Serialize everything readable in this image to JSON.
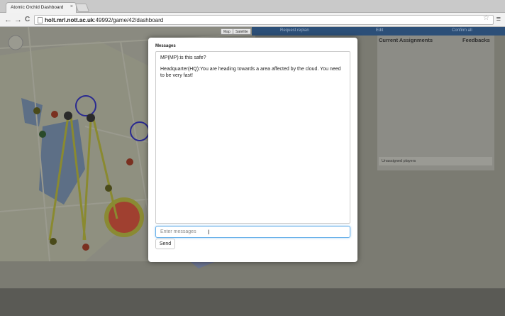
{
  "browser": {
    "tab_title": "Atomic Orchid Dashboard",
    "tab_close": "×",
    "back": "←",
    "forward": "→",
    "reload": "C",
    "url_host": "holt.mrl.nott.ac.uk",
    "url_path": ":49992/game/42/dashboard",
    "star": "☆",
    "menu": "≡"
  },
  "map": {
    "map_btn": "Map",
    "satellite_btn": "Satellite"
  },
  "top_tabs": [
    "Request replan",
    "Edit",
    "Confirm all"
  ],
  "assignments": {
    "current_label": "Current Assignments",
    "feedbacks_label": "Feedbacks",
    "unassigned_label": "Unassigned players"
  },
  "modal": {
    "title": "Messages",
    "messages": [
      "MP(MP):is this safe?",
      "Headquarter(HQ):You are heading towards a area affected by the cloud. You need to be very fast!"
    ],
    "input_placeholder": "Enter messages",
    "send_label": "Send"
  },
  "colors": {
    "modal_bg": "#ffffff",
    "input_focus": "#66afe9",
    "tab_bar": "#2c4f78",
    "overlay": "#7b7b72"
  }
}
